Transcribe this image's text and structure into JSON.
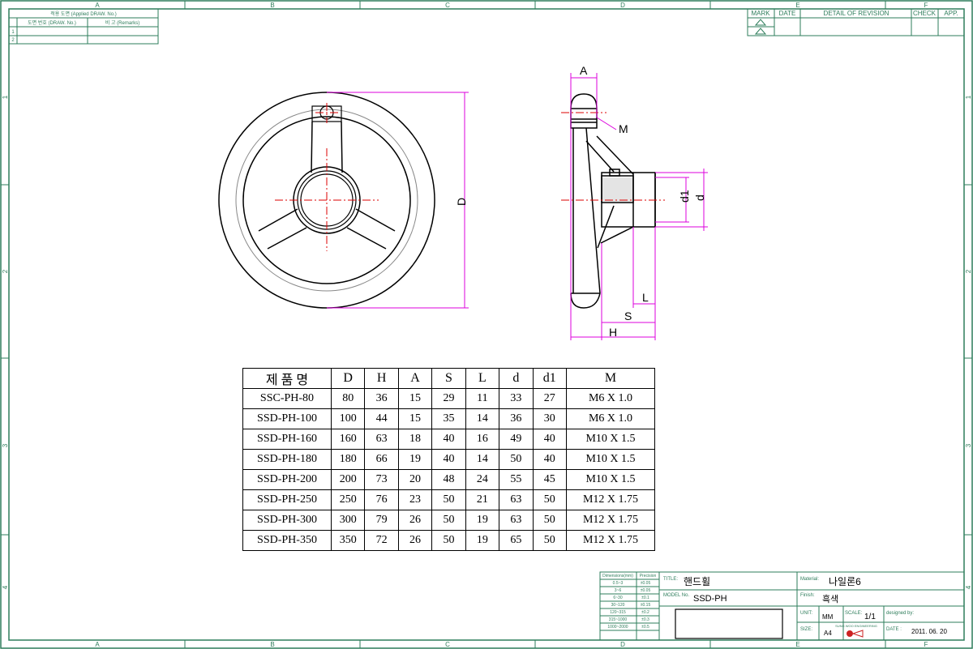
{
  "border": {
    "zone_cols": [
      "A",
      "B",
      "C",
      "D",
      "E",
      "F"
    ],
    "zone_rows": [
      "1",
      "2",
      "3",
      "4"
    ]
  },
  "applied_drawing": {
    "title": "적용 도면 (Applied DRAW. No.)",
    "col1": "도면 번호 (DRAW. No.)",
    "col2": "비 고 (Remarks)",
    "rows": [
      "1",
      "2"
    ]
  },
  "revision": {
    "headers": [
      "MARK",
      "DATE",
      "DETAIL OF REVISION",
      "CHECK",
      "APP."
    ]
  },
  "dimensions": {
    "A": "A",
    "M": "M",
    "D": "D",
    "d1": "d1",
    "d": "d",
    "L": "L",
    "S": "S",
    "H": "H"
  },
  "spec_table": {
    "headers": [
      "제 품 명",
      "D",
      "H",
      "A",
      "S",
      "L",
      "d",
      "d1",
      "M"
    ],
    "rows": [
      [
        "SSC-PH-80",
        "80",
        "36",
        "15",
        "29",
        "11",
        "33",
        "27",
        "M6 X 1.0"
      ],
      [
        "SSD-PH-100",
        "100",
        "44",
        "15",
        "35",
        "14",
        "36",
        "30",
        "M6 X 1.0"
      ],
      [
        "SSD-PH-160",
        "160",
        "63",
        "18",
        "40",
        "16",
        "49",
        "40",
        "M10 X 1.5"
      ],
      [
        "SSD-PH-180",
        "180",
        "66",
        "19",
        "40",
        "14",
        "50",
        "40",
        "M10 X 1.5"
      ],
      [
        "SSD-PH-200",
        "200",
        "73",
        "20",
        "48",
        "24",
        "55",
        "45",
        "M10 X 1.5"
      ],
      [
        "SSD-PH-250",
        "250",
        "76",
        "23",
        "50",
        "21",
        "63",
        "50",
        "M12 X 1.75"
      ],
      [
        "SSD-PH-300",
        "300",
        "79",
        "26",
        "50",
        "19",
        "63",
        "50",
        "M12 X 1.75"
      ],
      [
        "SSD-PH-350",
        "350",
        "72",
        "26",
        "50",
        "19",
        "65",
        "50",
        "M12 X 1.75"
      ]
    ]
  },
  "title_block": {
    "tolerance": {
      "header": [
        "Dimensions(mm)",
        "Precision"
      ],
      "rows": [
        [
          "0.5~3",
          "±0.05"
        ],
        [
          "3~6",
          "±0.05"
        ],
        [
          "6~30",
          "±0.1"
        ],
        [
          "30~120",
          "±0.15"
        ],
        [
          "120~315",
          "±0.2"
        ],
        [
          "315~1000",
          "±0.3"
        ],
        [
          "1000~2000",
          "±0.5"
        ]
      ]
    },
    "title_label": "TITLE:",
    "title": "핸드휠",
    "model_label": "MODEL No.",
    "model": "SSD-PH",
    "material_label": "Material:",
    "material": "나일론6",
    "finish_label": "Finish:",
    "finish": "흑색",
    "unit_label": "UNIT:",
    "unit": "MM",
    "scale_label": "SCALE:",
    "scale": "1/1",
    "designed_label": "designed by:",
    "size_label": "SIZE:",
    "size": "A4",
    "logo_text": "SUNG WOO ENGINEERING",
    "date_label": "DATE :",
    "date": "2011. 06. 20"
  }
}
